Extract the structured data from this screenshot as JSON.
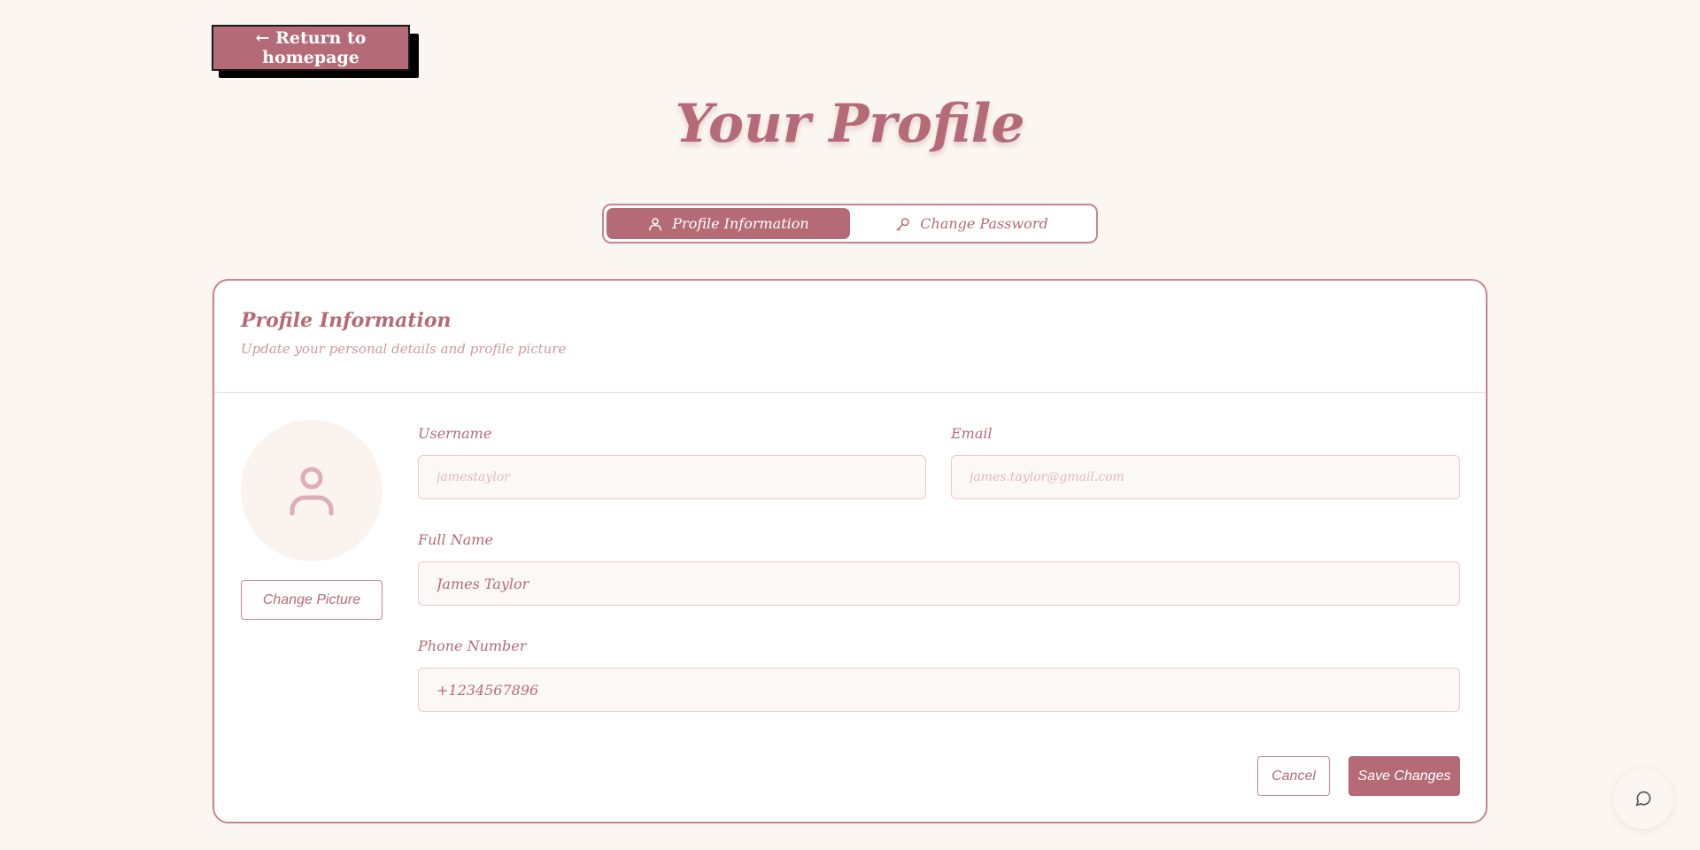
{
  "nav": {
    "return_label": "← Return to homepage"
  },
  "page": {
    "title": "Your Profile"
  },
  "tabs": [
    {
      "label": "Profile Information",
      "icon": "user-icon",
      "active": true
    },
    {
      "label": "Change Password",
      "icon": "key-icon",
      "active": false
    }
  ],
  "card": {
    "title": "Profile Information",
    "subtitle": "Update your personal details and profile picture",
    "change_picture_label": "Change Picture"
  },
  "form": {
    "username": {
      "label": "Username",
      "value": "",
      "placeholder": "jamestaylor"
    },
    "email": {
      "label": "Email",
      "value": "",
      "placeholder": "james.taylor@gmail.com"
    },
    "full_name": {
      "label": "Full Name",
      "value": "James Taylor"
    },
    "phone": {
      "label": "Phone Number",
      "value": "+1234567896"
    }
  },
  "actions": {
    "cancel_label": "Cancel",
    "save_label": "Save Changes"
  },
  "colors": {
    "accent": "#b56b77",
    "background": "#fbf6f1",
    "border": "#c9858f"
  }
}
